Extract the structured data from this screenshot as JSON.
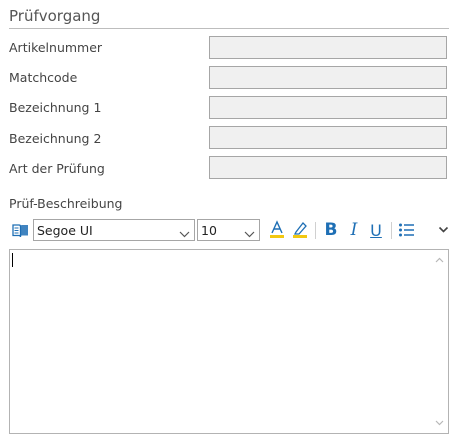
{
  "section": {
    "title": "Prüfvorgang"
  },
  "fields": [
    {
      "label": "Artikelnummer",
      "value": ""
    },
    {
      "label": "Matchcode",
      "value": ""
    },
    {
      "label": "Bezeichnung 1",
      "value": ""
    },
    {
      "label": "Bezeichnung 2",
      "value": ""
    },
    {
      "label": "Art der Prüfung",
      "value": ""
    }
  ],
  "description": {
    "label": "Prüf-Beschreibung",
    "text": ""
  },
  "toolbar": {
    "font_family": "Segoe UI",
    "font_size": "10",
    "icons": [
      "book-icon",
      "font-color-icon",
      "highlight-icon",
      "bold-icon",
      "italic-icon",
      "underline-icon",
      "bullet-list-icon",
      "more-chevron-icon"
    ]
  },
  "colors": {
    "accent": "#1e6fb5",
    "highlight_bar": "#f2c811",
    "input_bg": "#f0f0f0"
  }
}
